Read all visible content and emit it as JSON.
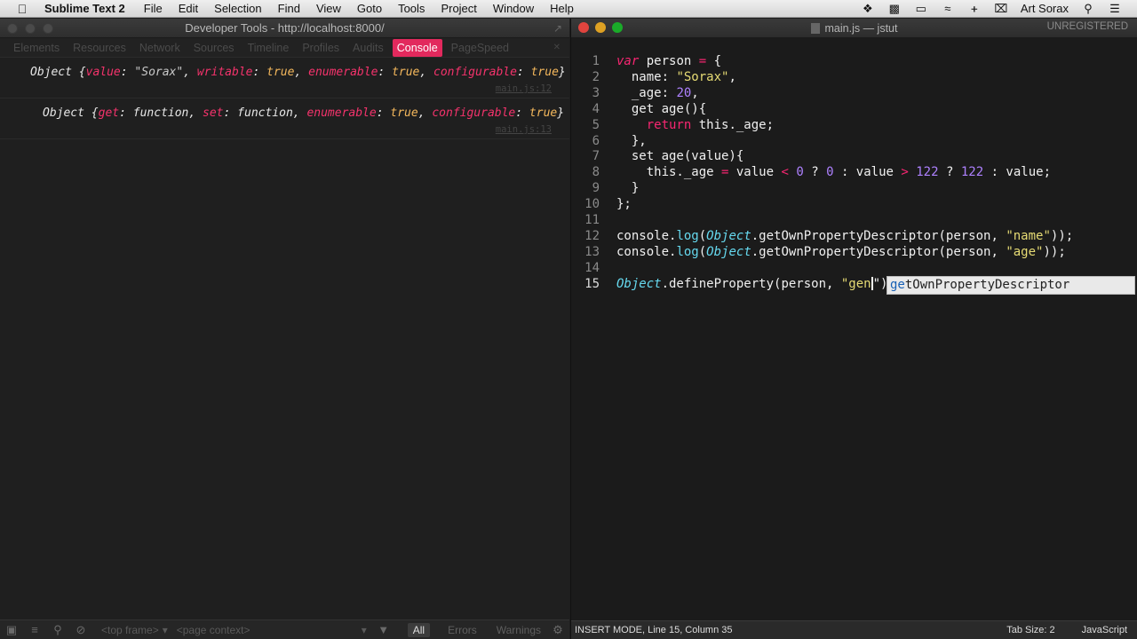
{
  "menubar": {
    "app_name": "Sublime Text 2",
    "items": [
      "File",
      "Edit",
      "Selection",
      "Find",
      "View",
      "Goto",
      "Tools",
      "Project",
      "Window",
      "Help"
    ],
    "user": "Art Sorax"
  },
  "devtools": {
    "title": "Developer Tools - http://localhost:8000/",
    "tabs": [
      "Elements",
      "Resources",
      "Network",
      "Sources",
      "Timeline",
      "Profiles",
      "Audits",
      "Console",
      "PageSpeed"
    ],
    "active_tab": "Console",
    "entries": [
      {
        "parts": [
          {
            "t": "Object {",
            "c": ""
          },
          {
            "t": "value",
            "c": "k"
          },
          {
            "t": ": ",
            "c": ""
          },
          {
            "t": "\"Sorax\"",
            "c": "s"
          },
          {
            "t": ", ",
            "c": ""
          },
          {
            "t": "writable",
            "c": "k"
          },
          {
            "t": ": ",
            "c": ""
          },
          {
            "t": "true",
            "c": "v"
          },
          {
            "t": ", ",
            "c": ""
          },
          {
            "t": "enumerable",
            "c": "k"
          },
          {
            "t": ": ",
            "c": ""
          },
          {
            "t": "true",
            "c": "v"
          },
          {
            "t": ", ",
            "c": ""
          },
          {
            "t": "configurable",
            "c": "k"
          },
          {
            "t": ": ",
            "c": ""
          },
          {
            "t": "true",
            "c": "v"
          },
          {
            "t": "}",
            "c": ""
          }
        ],
        "source": "main.js:12"
      },
      {
        "parts": [
          {
            "t": "Object {",
            "c": ""
          },
          {
            "t": "get",
            "c": "k"
          },
          {
            "t": ": function, ",
            "c": ""
          },
          {
            "t": "set",
            "c": "k"
          },
          {
            "t": ": function, ",
            "c": ""
          },
          {
            "t": "enumerable",
            "c": "k"
          },
          {
            "t": ": ",
            "c": ""
          },
          {
            "t": "true",
            "c": "v"
          },
          {
            "t": ", ",
            "c": ""
          },
          {
            "t": "configurable",
            "c": "k"
          },
          {
            "t": ": ",
            "c": ""
          },
          {
            "t": "true",
            "c": "v"
          },
          {
            "t": "}",
            "c": ""
          }
        ],
        "source": "main.js:13"
      }
    ],
    "bottombar": {
      "frame_select": "<top frame>",
      "context_select": "<page context>",
      "filters": [
        "All",
        "Errors",
        "Warnings"
      ],
      "active_filter": "All"
    }
  },
  "sublime": {
    "title": "main.js — jstut",
    "unregistered": "UNREGISTERED",
    "current_line": 15,
    "lines": [
      [
        {
          "t": "var",
          "c": "kw"
        },
        {
          "t": " person ",
          "c": ""
        },
        {
          "t": "=",
          "c": "op"
        },
        {
          "t": " {",
          "c": ""
        }
      ],
      [
        {
          "t": "  ",
          "c": "ind"
        },
        {
          "t": "name: ",
          "c": ""
        },
        {
          "t": "\"Sorax\"",
          "c": "str"
        },
        {
          "t": ",",
          "c": ""
        }
      ],
      [
        {
          "t": "  ",
          "c": "ind"
        },
        {
          "t": "_age: ",
          "c": ""
        },
        {
          "t": "20",
          "c": "num"
        },
        {
          "t": ",",
          "c": ""
        }
      ],
      [
        {
          "t": "  ",
          "c": "ind"
        },
        {
          "t": "get age(){",
          "c": ""
        }
      ],
      [
        {
          "t": "    ",
          "c": "ind"
        },
        {
          "t": "return",
          "c": "kw2"
        },
        {
          "t": " this._age;",
          "c": ""
        }
      ],
      [
        {
          "t": "  ",
          "c": "ind"
        },
        {
          "t": "},",
          "c": ""
        }
      ],
      [
        {
          "t": "  ",
          "c": "ind"
        },
        {
          "t": "set age(value){",
          "c": ""
        }
      ],
      [
        {
          "t": "    ",
          "c": "ind"
        },
        {
          "t": "this._age ",
          "c": ""
        },
        {
          "t": "=",
          "c": "op"
        },
        {
          "t": " value ",
          "c": ""
        },
        {
          "t": "<",
          "c": "op"
        },
        {
          "t": " ",
          "c": ""
        },
        {
          "t": "0",
          "c": "num"
        },
        {
          "t": " ? ",
          "c": ""
        },
        {
          "t": "0",
          "c": "num"
        },
        {
          "t": " : value ",
          "c": ""
        },
        {
          "t": ">",
          "c": "op"
        },
        {
          "t": " ",
          "c": ""
        },
        {
          "t": "122",
          "c": "num"
        },
        {
          "t": " ? ",
          "c": ""
        },
        {
          "t": "122",
          "c": "num"
        },
        {
          "t": " : value;",
          "c": ""
        }
      ],
      [
        {
          "t": "  ",
          "c": "ind"
        },
        {
          "t": "}",
          "c": ""
        }
      ],
      [
        {
          "t": "};",
          "c": ""
        }
      ],
      [],
      [
        {
          "t": "console.",
          "c": ""
        },
        {
          "t": "log",
          "c": "fn"
        },
        {
          "t": "(",
          "c": ""
        },
        {
          "t": "Object",
          "c": "obj"
        },
        {
          "t": ".getOwnPropertyDescriptor(person, ",
          "c": ""
        },
        {
          "t": "\"name\"",
          "c": "str"
        },
        {
          "t": "));",
          "c": ""
        }
      ],
      [
        {
          "t": "console.",
          "c": ""
        },
        {
          "t": "log",
          "c": "fn"
        },
        {
          "t": "(",
          "c": ""
        },
        {
          "t": "Object",
          "c": "obj"
        },
        {
          "t": ".getOwnPropertyDescriptor(person, ",
          "c": ""
        },
        {
          "t": "\"age\"",
          "c": "str"
        },
        {
          "t": "));",
          "c": ""
        }
      ],
      [],
      [
        {
          "t": "Object",
          "c": "obj"
        },
        {
          "t": ".defineProperty(person, ",
          "c": ""
        },
        {
          "t": "\"gen",
          "c": "str"
        },
        {
          "t": "|",
          "c": "cursor"
        },
        {
          "t": "\")",
          "c": ""
        }
      ]
    ],
    "autocomplete": {
      "match": "ge",
      "rest": "tOwnPropertyDescriptor"
    },
    "status": {
      "left": "INSERT MODE, Line 15, Column 35",
      "tab_size": "Tab Size: 2",
      "syntax": "JavaScript"
    }
  }
}
